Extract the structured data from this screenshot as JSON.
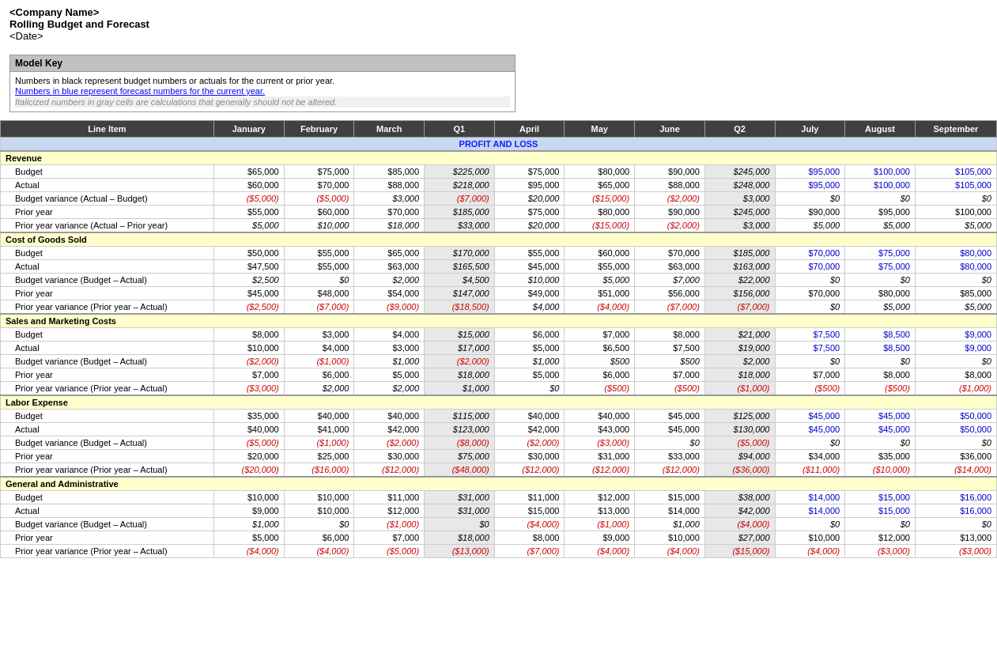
{
  "header": {
    "company": "<Company Name>",
    "title": "Rolling Budget and Forecast",
    "date": "<Date>"
  },
  "modelKey": {
    "title": "Model Key",
    "line1": "Numbers in black represent budget numbers or actuals for the current or prior year.",
    "line2": "Numbers in blue represent forecast numbers for the current year.",
    "line3": "Italicized numbers in gray cells are calculations that generally should not be altered."
  },
  "columns": {
    "lineItem": "Line Item",
    "jan": "January",
    "feb": "February",
    "mar": "March",
    "q1": "Q1",
    "apr": "April",
    "may": "May",
    "jun": "June",
    "q2": "Q2",
    "jul": "July",
    "aug": "August",
    "sep": "September"
  },
  "sections": [
    {
      "name": "PROFIT AND LOSS",
      "type": "pl-header"
    },
    {
      "name": "Revenue",
      "type": "section-header",
      "rows": [
        {
          "label": "Budget",
          "type": "budget",
          "jan": "$65,000",
          "feb": "$75,000",
          "mar": "$85,000",
          "q1": "$225,000",
          "apr": "$75,000",
          "may": "$80,000",
          "jun": "$90,000",
          "q2": "$245,000",
          "jul": "$95,000",
          "aug": "$100,000",
          "sep": "$105,000",
          "julBlue": true,
          "augBlue": true,
          "sepBlue": true
        },
        {
          "label": "Actual",
          "type": "actual",
          "jan": "$60,000",
          "feb": "$70,000",
          "mar": "$88,000",
          "q1": "$218,000",
          "apr": "$95,000",
          "may": "$65,000",
          "jun": "$88,000",
          "q2": "$248,000",
          "jul": "$95,000",
          "aug": "$100,000",
          "sep": "$105,000",
          "julBlue": true,
          "augBlue": true,
          "sepBlue": true
        },
        {
          "label": "Budget variance (Actual – Budget)",
          "type": "variance",
          "jan": "($5,000)",
          "feb": "($5,000)",
          "mar": "$3,000",
          "q1": "($7,000)",
          "apr": "$20,000",
          "may": "($15,000)",
          "jun": "($2,000)",
          "q2": "$3,000",
          "jul": "$0",
          "aug": "$0",
          "sep": "$0",
          "marPos": true,
          "aprPos": true,
          "q2Pos": true
        },
        {
          "label": "Prior year",
          "type": "prioryear",
          "jan": "$55,000",
          "feb": "$60,000",
          "mar": "$70,000",
          "q1": "$185,000",
          "apr": "$75,000",
          "may": "$80,000",
          "jun": "$90,000",
          "q2": "$245,000",
          "jul": "$90,000",
          "aug": "$95,000",
          "sep": "$100,000"
        },
        {
          "label": "Prior year variance (Actual – Prior year)",
          "type": "prioryear-variance",
          "jan": "$5,000",
          "feb": "$10,000",
          "mar": "$18,000",
          "q1": "$33,000",
          "apr": "$20,000",
          "may": "($15,000)",
          "jun": "($2,000)",
          "q2": "$3,000",
          "jul": "$5,000",
          "aug": "$5,000",
          "sep": "$5,000",
          "janPos": true,
          "febPos": true,
          "marPos": true,
          "q1Pos": true,
          "aprPos": true,
          "q2Pos": true,
          "julPos": true,
          "augPos": true,
          "sepPos": true
        }
      ]
    },
    {
      "name": "Cost of Goods Sold",
      "type": "section-header",
      "rows": [
        {
          "label": "Budget",
          "type": "budget",
          "jan": "$50,000",
          "feb": "$55,000",
          "mar": "$65,000",
          "q1": "$170,000",
          "apr": "$55,000",
          "may": "$60,000",
          "jun": "$70,000",
          "q2": "$185,000",
          "jul": "$70,000",
          "aug": "$75,000",
          "sep": "$80,000",
          "julBlue": true,
          "augBlue": true,
          "sepBlue": true
        },
        {
          "label": "Actual",
          "type": "actual",
          "jan": "$47,500",
          "feb": "$55,000",
          "mar": "$63,000",
          "q1": "$165,500",
          "apr": "$45,000",
          "may": "$55,000",
          "jun": "$63,000",
          "q2": "$163,000",
          "jul": "$70,000",
          "aug": "$75,000",
          "sep": "$80,000",
          "julBlue": true,
          "augBlue": true,
          "sepBlue": true
        },
        {
          "label": "Budget variance (Budget – Actual)",
          "type": "variance",
          "jan": "$2,500",
          "feb": "$0",
          "mar": "$2,000",
          "q1": "$4,500",
          "apr": "$10,000",
          "may": "$5,000",
          "jun": "$7,000",
          "q2": "$22,000",
          "jul": "$0",
          "aug": "$0",
          "sep": "$0",
          "janPos": true,
          "marPos": true,
          "q1Pos": true,
          "aprPos": true,
          "mayPos": true,
          "junPos": true,
          "q2Pos": true
        },
        {
          "label": "Prior year",
          "type": "prioryear",
          "jan": "$45,000",
          "feb": "$48,000",
          "mar": "$54,000",
          "q1": "$147,000",
          "apr": "$49,000",
          "may": "$51,000",
          "jun": "$56,000",
          "q2": "$156,000",
          "jul": "$70,000",
          "aug": "$80,000",
          "sep": "$85,000"
        },
        {
          "label": "Prior year variance (Prior year – Actual)",
          "type": "prioryear-variance",
          "jan": "($2,500)",
          "feb": "($7,000)",
          "mar": "($9,000)",
          "q1": "($18,500)",
          "apr": "$4,000",
          "may": "($4,000)",
          "jun": "($7,000)",
          "q2": "($7,000)",
          "jul": "$0",
          "aug": "$5,000",
          "sep": "$5,000",
          "aprPos": true,
          "julPos": true,
          "augPos": true,
          "sepPos": true
        }
      ]
    },
    {
      "name": "Sales and Marketing Costs",
      "type": "section-header",
      "rows": [
        {
          "label": "Budget",
          "type": "budget",
          "jan": "$8,000",
          "feb": "$3,000",
          "mar": "$4,000",
          "q1": "$15,000",
          "apr": "$6,000",
          "may": "$7,000",
          "jun": "$8,000",
          "q2": "$21,000",
          "jul": "$7,500",
          "aug": "$8,500",
          "sep": "$9,000",
          "julBlue": true,
          "augBlue": true,
          "sepBlue": true
        },
        {
          "label": "Actual",
          "type": "actual",
          "jan": "$10,000",
          "feb": "$4,000",
          "mar": "$3,000",
          "q1": "$17,000",
          "apr": "$5,000",
          "may": "$6,500",
          "jun": "$7,500",
          "q2": "$19,000",
          "jul": "$7,500",
          "aug": "$8,500",
          "sep": "$9,000",
          "julBlue": true,
          "augBlue": true,
          "sepBlue": true
        },
        {
          "label": "Budget variance (Budget – Actual)",
          "type": "variance",
          "jan": "($2,000)",
          "feb": "($1,000)",
          "mar": "$1,000",
          "q1": "($2,000)",
          "apr": "$1,000",
          "may": "$500",
          "jun": "$500",
          "q2": "$2,000",
          "jul": "$0",
          "aug": "$0",
          "sep": "$0",
          "marPos": true,
          "aprPos": true,
          "mayPos": true,
          "junPos": true,
          "q2Pos": true
        },
        {
          "label": "Prior year",
          "type": "prioryear",
          "jan": "$7,000",
          "feb": "$6,000",
          "mar": "$5,000",
          "q1": "$18,000",
          "apr": "$5,000",
          "may": "$6,000",
          "jun": "$7,000",
          "q2": "$18,000",
          "jul": "$7,000",
          "aug": "$8,000",
          "sep": "$8,000"
        },
        {
          "label": "Prior year variance (Prior year – Actual)",
          "type": "prioryear-variance",
          "jan": "($3,000)",
          "feb": "$2,000",
          "mar": "$2,000",
          "q1": "$1,000",
          "apr": "$0",
          "may": "($500)",
          "jun": "($500)",
          "q2": "($1,000)",
          "jul": "($500)",
          "aug": "($500)",
          "sep": "($1,000)",
          "febPos": true,
          "marPos": true,
          "q1Pos": true
        }
      ]
    },
    {
      "name": "Labor Expense",
      "type": "section-header",
      "rows": [
        {
          "label": "Budget",
          "type": "budget",
          "jan": "$35,000",
          "feb": "$40,000",
          "mar": "$40,000",
          "q1": "$115,000",
          "apr": "$40,000",
          "may": "$40,000",
          "jun": "$45,000",
          "q2": "$125,000",
          "jul": "$45,000",
          "aug": "$45,000",
          "sep": "$50,000",
          "julBlue": true,
          "augBlue": true,
          "sepBlue": true
        },
        {
          "label": "Actual",
          "type": "actual",
          "jan": "$40,000",
          "feb": "$41,000",
          "mar": "$42,000",
          "q1": "$123,000",
          "apr": "$42,000",
          "may": "$43,000",
          "jun": "$45,000",
          "q2": "$130,000",
          "jul": "$45,000",
          "aug": "$45,000",
          "sep": "$50,000",
          "julBlue": true,
          "augBlue": true,
          "sepBlue": true
        },
        {
          "label": "Budget variance (Budget – Actual)",
          "type": "variance",
          "jan": "($5,000)",
          "feb": "($1,000)",
          "mar": "($2,000)",
          "q1": "($8,000)",
          "apr": "($2,000)",
          "may": "($3,000)",
          "jun": "$0",
          "q2": "($5,000)",
          "jul": "$0",
          "aug": "$0",
          "sep": "$0",
          "junPos": true
        },
        {
          "label": "Prior year",
          "type": "prioryear",
          "jan": "$20,000",
          "feb": "$25,000",
          "mar": "$30,000",
          "q1": "$75,000",
          "apr": "$30,000",
          "may": "$31,000",
          "jun": "$33,000",
          "q2": "$94,000",
          "jul": "$34,000",
          "aug": "$35,000",
          "sep": "$36,000"
        },
        {
          "label": "Prior year variance (Prior year – Actual)",
          "type": "prioryear-variance",
          "jan": "($20,000)",
          "feb": "($16,000)",
          "mar": "($12,000)",
          "q1": "($48,000)",
          "apr": "($12,000)",
          "may": "($12,000)",
          "jun": "($12,000)",
          "q2": "($36,000)",
          "jul": "($11,000)",
          "aug": "($10,000)",
          "sep": "($14,000)"
        }
      ]
    },
    {
      "name": "General and Administrative",
      "type": "section-header",
      "rows": [
        {
          "label": "Budget",
          "type": "budget",
          "jan": "$10,000",
          "feb": "$10,000",
          "mar": "$11,000",
          "q1": "$31,000",
          "apr": "$11,000",
          "may": "$12,000",
          "jun": "$15,000",
          "q2": "$38,000",
          "jul": "$14,000",
          "aug": "$15,000",
          "sep": "$16,000",
          "julBlue": true,
          "augBlue": true,
          "sepBlue": true
        },
        {
          "label": "Actual",
          "type": "actual",
          "jan": "$9,000",
          "feb": "$10,000",
          "mar": "$12,000",
          "q1": "$31,000",
          "apr": "$15,000",
          "may": "$13,000",
          "jun": "$14,000",
          "q2": "$42,000",
          "jul": "$14,000",
          "aug": "$15,000",
          "sep": "$16,000",
          "julBlue": true,
          "augBlue": true,
          "sepBlue": true
        },
        {
          "label": "Budget variance (Budget – Actual)",
          "type": "variance",
          "jan": "$1,000",
          "feb": "$0",
          "mar": "($1,000)",
          "q1": "$0",
          "apr": "($4,000)",
          "may": "($1,000)",
          "jun": "$1,000",
          "q2": "($4,000)",
          "jul": "$0",
          "aug": "$0",
          "sep": "$0",
          "janPos": true,
          "junPos": true
        },
        {
          "label": "Prior year",
          "type": "prioryear",
          "jan": "$5,000",
          "feb": "$6,000",
          "mar": "$7,000",
          "q1": "$18,000",
          "apr": "$8,000",
          "may": "$9,000",
          "jun": "$10,000",
          "q2": "$27,000",
          "jul": "$10,000",
          "aug": "$12,000",
          "sep": "$13,000"
        },
        {
          "label": "Prior year variance (Prior year – Actual)",
          "type": "prioryear-variance",
          "jan": "($4,000)",
          "feb": "($4,000)",
          "mar": "($5,000)",
          "q1": "($13,000)",
          "apr": "($7,000)",
          "may": "($4,000)",
          "jun": "($4,000)",
          "q2": "($15,000)",
          "jul": "($4,000)",
          "aug": "($3,000)",
          "sep": "($3,000)"
        }
      ]
    }
  ]
}
